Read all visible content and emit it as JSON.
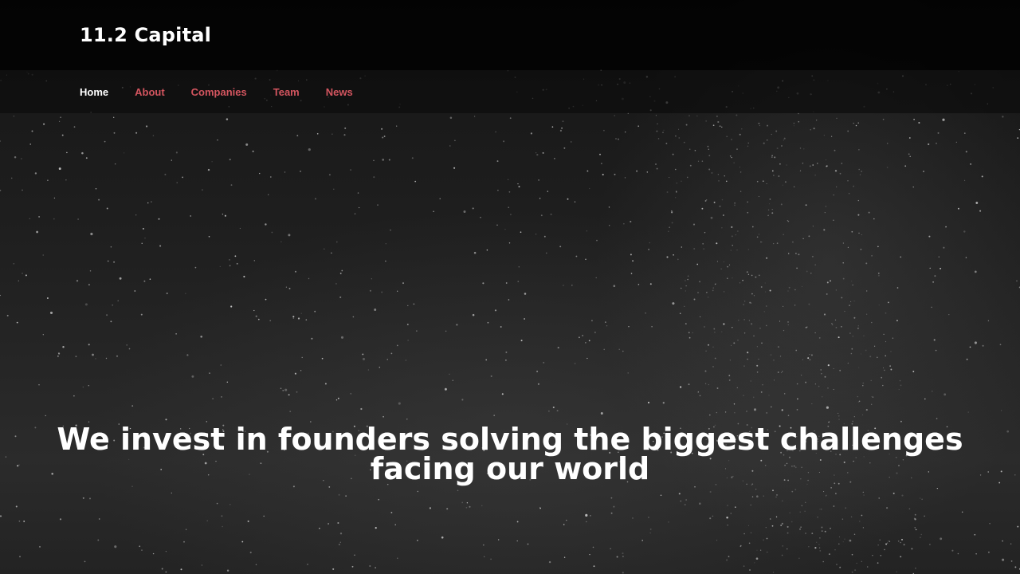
{
  "header": {
    "brand": "11.2 Capital"
  },
  "nav": {
    "items": [
      {
        "label": "Home",
        "active": true
      },
      {
        "label": "About",
        "active": false
      },
      {
        "label": "Companies",
        "active": false
      },
      {
        "label": "Team",
        "active": false
      },
      {
        "label": "News",
        "active": false
      }
    ]
  },
  "hero": {
    "title": "We invest in founders solving the biggest challenges facing our world"
  },
  "colors": {
    "accent": "#d3555f",
    "active_link": "#ffffff",
    "header_bg": "#050505"
  }
}
